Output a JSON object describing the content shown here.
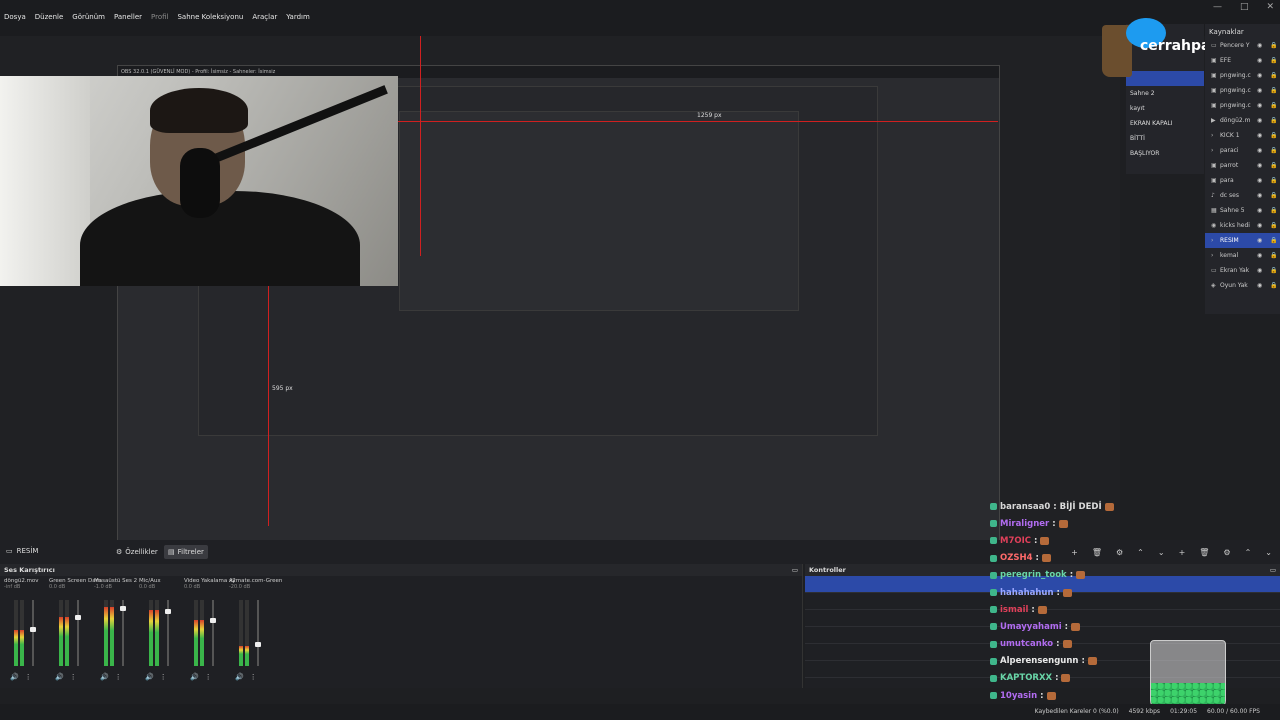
{
  "menu": {
    "items": [
      "Dosya",
      "Düzenle",
      "Görünüm",
      "Paneller",
      "Profil",
      "Sahne Koleksiyonu",
      "Araçlar",
      "Yardım"
    ]
  },
  "preview": {
    "nested_title": "OBS 32.0.1 (GÜVENLİ MOD) - Profil: İsimsiz - Sahneler: İsimsiz",
    "label_1259": "1259 px",
    "label_595": "595 px"
  },
  "brand": {
    "name": "cerrahpasali"
  },
  "scenes": {
    "items": [
      "Sahne 2",
      "kayıt",
      "EKRAN KAPALI",
      "BİTTİ",
      "BAŞLIYOR"
    ]
  },
  "sources": {
    "title": "Kaynaklar",
    "items": [
      {
        "name": "Pencere Y",
        "icon": "window-icon",
        "active": false
      },
      {
        "name": "EFE",
        "icon": "image-icon",
        "active": false
      },
      {
        "name": "pngwing.c",
        "icon": "image-icon",
        "active": false
      },
      {
        "name": "pngwing.c",
        "icon": "image-icon",
        "active": false
      },
      {
        "name": "pngwing.c",
        "icon": "image-icon",
        "active": false
      },
      {
        "name": "döngü2.m",
        "icon": "play-icon",
        "active": false
      },
      {
        "name": "KİCK 1",
        "icon": "chevron-icon",
        "active": false
      },
      {
        "name": "paraci",
        "icon": "chevron-icon",
        "active": false
      },
      {
        "name": "parrot",
        "icon": "image-icon",
        "active": false
      },
      {
        "name": "para",
        "icon": "image-icon",
        "active": false
      },
      {
        "name": "dc ses",
        "icon": "audio-icon",
        "active": false
      },
      {
        "name": "Sahne 5",
        "icon": "scene-icon",
        "active": false
      },
      {
        "name": "kicks hedi",
        "icon": "browser-icon",
        "active": false
      },
      {
        "name": "RESİM",
        "icon": "chevron-icon",
        "active": true
      },
      {
        "name": "kemal",
        "icon": "chevron-icon",
        "active": false
      },
      {
        "name": "Ekran Yak",
        "icon": "monitor-icon",
        "active": false
      },
      {
        "name": "Oyun Yak",
        "icon": "gamepad-icon",
        "active": false
      }
    ]
  },
  "toolbar": {
    "scene_name": "RESİM",
    "properties_label": "Özellikler",
    "filters_label": "Filtreler"
  },
  "mixer": {
    "title": "Ses Karıştırıcı",
    "channels": [
      {
        "name": "döngü2.mov",
        "db": "-inf dB",
        "level": 0.55
      },
      {
        "name": "Green Screen Dam",
        "db": "0.0 dB",
        "level": 0.75
      },
      {
        "name": "Masaüstü Ses 2",
        "db": "-1.0 dB",
        "level": 0.9
      },
      {
        "name": "Mic/Aux",
        "db": "0.0 dB",
        "level": 0.85
      },
      {
        "name": "Video Yakalama Ay",
        "db": "0.0 dB",
        "level": 0.7
      },
      {
        "name": "x2mate.com-Green",
        "db": "-20.0 dB",
        "level": 0.3
      }
    ]
  },
  "controls": {
    "title": "Kontroller"
  },
  "chat": [
    {
      "user": "baransaa0",
      "msg": ": BİJİ DEDİ",
      "color": "#d8d8d8"
    },
    {
      "user": "Miraligner",
      "msg": ":",
      "color": "#b16cf0"
    },
    {
      "user": "M7OIC",
      "msg": ":",
      "color": "#e0405a"
    },
    {
      "user": "OZSH4",
      "msg": ":",
      "color": "#ff6a6a"
    },
    {
      "user": "peregrin_took",
      "msg": ":",
      "color": "#69d6a8"
    },
    {
      "user": "hahahahun",
      "msg": ":",
      "color": "#9aa7ff"
    },
    {
      "user": "ismail",
      "msg": ":",
      "color": "#e0405a"
    },
    {
      "user": "Umayyahami",
      "msg": ":",
      "color": "#b16cf0"
    },
    {
      "user": "umutcanko",
      "msg": ":",
      "color": "#b16cf0"
    },
    {
      "user": "Alperensengunn",
      "msg": ":",
      "color": "#e8e8e8"
    },
    {
      "user": "KAPTORXX",
      "msg": ":",
      "color": "#69d6a8"
    },
    {
      "user": "10yasin",
      "msg": ":",
      "color": "#b16cf0"
    }
  ],
  "status": {
    "dropped": "Kaybedilen Kareler 0 (%0.0)",
    "bitrate": "4592 kbps",
    "time": "01:29:05",
    "fps": "60.00 / 60.00 FPS"
  },
  "colors": {
    "accent": "#2c4aa8",
    "guide": "#d02020",
    "twitter": "#1d9bf0"
  }
}
